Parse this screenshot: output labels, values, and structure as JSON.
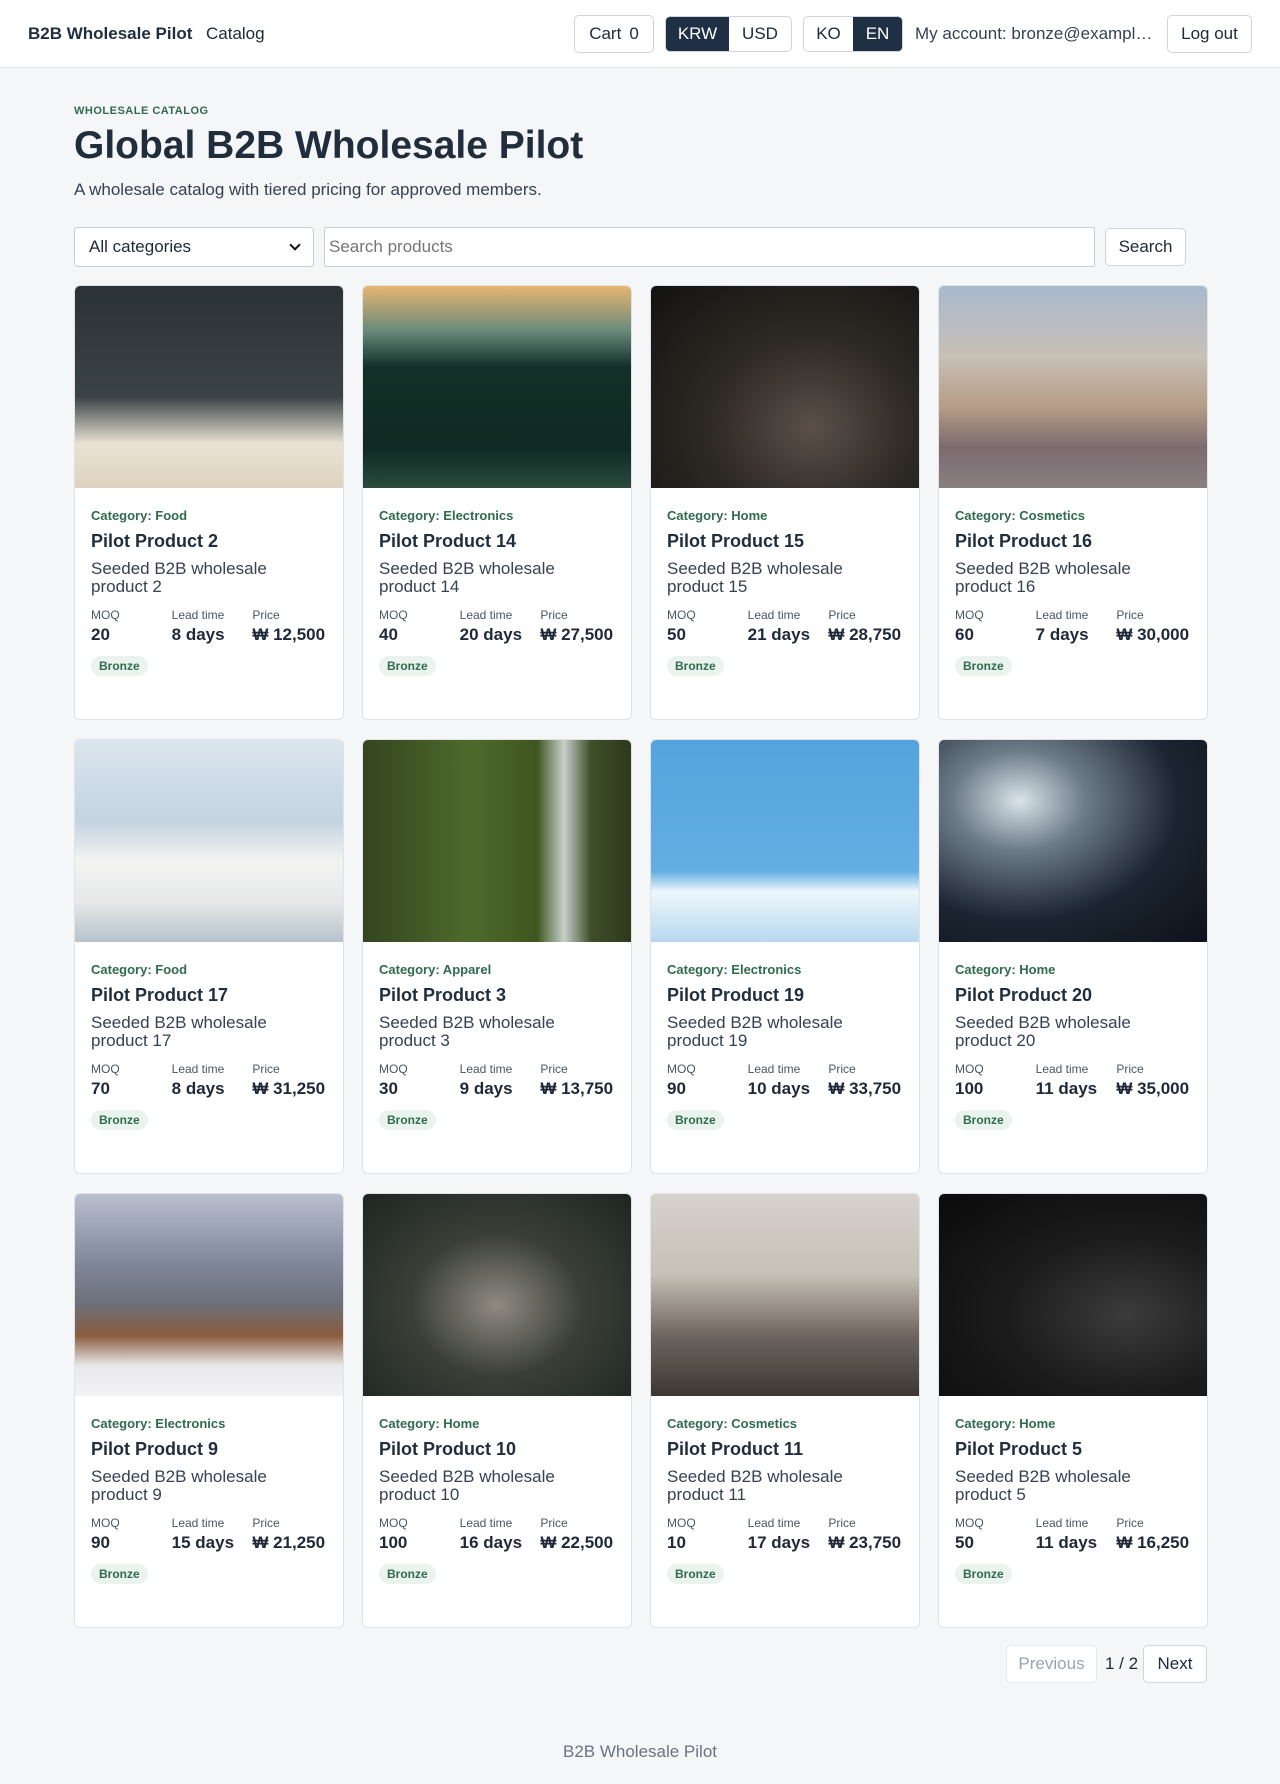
{
  "header": {
    "brand": "B2B Wholesale Pilot",
    "nav_catalog": "Catalog",
    "cart_label": "Cart",
    "cart_count": "0",
    "currencies": [
      "KRW",
      "USD"
    ],
    "currency_selected": "KRW",
    "languages": [
      "KO",
      "EN"
    ],
    "language_selected": "EN",
    "account": "My account: bronze@example....",
    "logout": "Log out"
  },
  "hero": {
    "eyebrow": "WHOLESALE CATALOG",
    "title": "Global B2B Wholesale Pilot",
    "subtitle": "A wholesale catalog with tiered pricing for approved members."
  },
  "filters": {
    "category_selected": "All categories",
    "search_placeholder": "Search products",
    "search_button": "Search"
  },
  "labels": {
    "moq": "MOQ",
    "lead_time": "Lead time",
    "price": "Price"
  },
  "products": [
    {
      "category": "Category: Food",
      "name": "Pilot Product 2",
      "desc": "Seeded B2B wholesale product 2",
      "moq": "20",
      "lead": "8 days",
      "price": "₩ 12,500",
      "tier": "Bronze"
    },
    {
      "category": "Category: Electronics",
      "name": "Pilot Product 14",
      "desc": "Seeded B2B wholesale product 14",
      "moq": "40",
      "lead": "20 days",
      "price": "₩ 27,500",
      "tier": "Bronze"
    },
    {
      "category": "Category: Home",
      "name": "Pilot Product 15",
      "desc": "Seeded B2B wholesale product 15",
      "moq": "50",
      "lead": "21 days",
      "price": "₩ 28,750",
      "tier": "Bronze"
    },
    {
      "category": "Category: Cosmetics",
      "name": "Pilot Product 16",
      "desc": "Seeded B2B wholesale product 16",
      "moq": "60",
      "lead": "7 days",
      "price": "₩ 30,000",
      "tier": "Bronze"
    },
    {
      "category": "Category: Food",
      "name": "Pilot Product 17",
      "desc": "Seeded B2B wholesale product 17",
      "moq": "70",
      "lead": "8 days",
      "price": "₩ 31,250",
      "tier": "Bronze"
    },
    {
      "category": "Category: Apparel",
      "name": "Pilot Product 3",
      "desc": "Seeded B2B wholesale product 3",
      "moq": "30",
      "lead": "9 days",
      "price": "₩ 13,750",
      "tier": "Bronze"
    },
    {
      "category": "Category: Electronics",
      "name": "Pilot Product 19",
      "desc": "Seeded B2B wholesale product 19",
      "moq": "90",
      "lead": "10 days",
      "price": "₩ 33,750",
      "tier": "Bronze"
    },
    {
      "category": "Category: Home",
      "name": "Pilot Product 20",
      "desc": "Seeded B2B wholesale product 20",
      "moq": "100",
      "lead": "11 days",
      "price": "₩ 35,000",
      "tier": "Bronze"
    },
    {
      "category": "Category: Electronics",
      "name": "Pilot Product 9",
      "desc": "Seeded B2B wholesale product 9",
      "moq": "90",
      "lead": "15 days",
      "price": "₩ 21,250",
      "tier": "Bronze"
    },
    {
      "category": "Category: Home",
      "name": "Pilot Product 10",
      "desc": "Seeded B2B wholesale product 10",
      "moq": "100",
      "lead": "16 days",
      "price": "₩ 22,500",
      "tier": "Bronze"
    },
    {
      "category": "Category: Cosmetics",
      "name": "Pilot Product 11",
      "desc": "Seeded B2B wholesale product 11",
      "moq": "10",
      "lead": "17 days",
      "price": "₩ 23,750",
      "tier": "Bronze"
    },
    {
      "category": "Category: Home",
      "name": "Pilot Product 5",
      "desc": "Seeded B2B wholesale product 5",
      "moq": "50",
      "lead": "11 days",
      "price": "₩ 16,250",
      "tier": "Bronze"
    }
  ],
  "pagination": {
    "previous": "Previous",
    "page_info": "1 / 2",
    "next": "Next"
  },
  "footer": "B2B Wholesale Pilot",
  "colors": {
    "accent_dark": "#1f3044",
    "category_green": "#2f6b4f",
    "badge_bg": "#eaf3ee"
  }
}
